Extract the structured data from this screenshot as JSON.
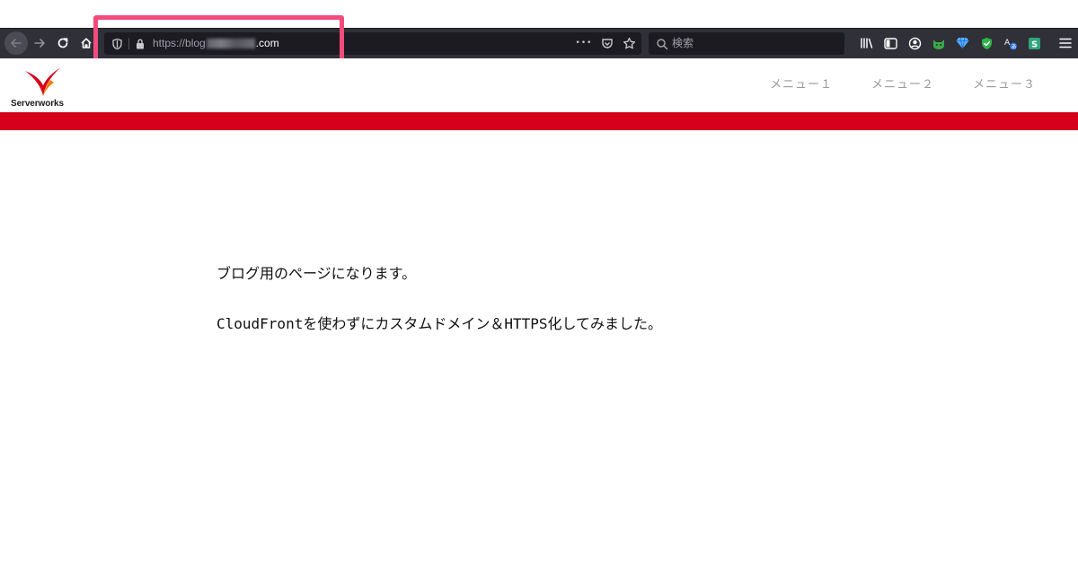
{
  "browser": {
    "url_prefix": "https://blog",
    "url_tld": ".com",
    "search_placeholder": "検索",
    "url_more_label": "•••"
  },
  "site": {
    "logo_text": "Serverworks",
    "nav": [
      {
        "label": "メニュー１"
      },
      {
        "label": "メニュー２"
      },
      {
        "label": "メニュー３"
      }
    ],
    "accent_color": "#d6001c"
  },
  "content": {
    "line1": "ブログ用のページになります。",
    "line2": "CloudFrontを使わずにカスタムドメイン＆HTTPS化してみました。"
  },
  "annotation": {
    "highlight_color": "#f24b7e"
  }
}
